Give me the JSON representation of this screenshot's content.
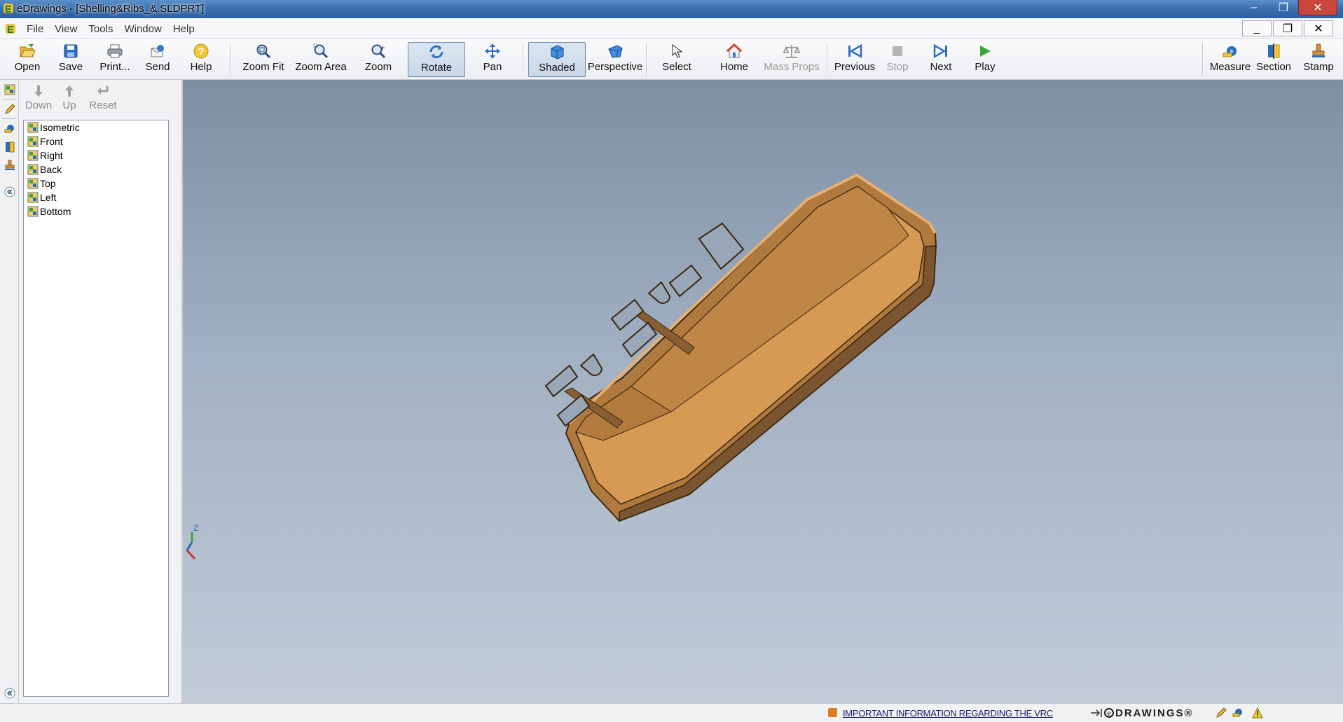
{
  "window": {
    "title": "eDrawings - [Shelling&Ribs_&.SLDPRT]",
    "minimize": "–",
    "restore": "❐",
    "close": "✕"
  },
  "menu": {
    "items": [
      "File",
      "View",
      "Tools",
      "Window",
      "Help"
    ],
    "mdi_minimize": "_",
    "mdi_restore": "❐",
    "mdi_close": "✕"
  },
  "toolbar": {
    "open": "Open",
    "save": "Save",
    "print": "Print...",
    "send": "Send",
    "help": "Help",
    "zoom_fit": "Zoom Fit",
    "zoom_area": "Zoom Area",
    "zoom": "Zoom",
    "rotate": "Rotate",
    "pan": "Pan",
    "shaded": "Shaded",
    "perspective": "Perspective",
    "select": "Select",
    "home": "Home",
    "mass_props": "Mass Props",
    "previous": "Previous",
    "stop": "Stop",
    "next": "Next",
    "play": "Play",
    "measure": "Measure",
    "section": "Section",
    "stamp": "Stamp"
  },
  "panel": {
    "down": "Down",
    "up": "Up",
    "reset": "Reset",
    "views": [
      "Isometric",
      "Front",
      "Right",
      "Back",
      "Top",
      "Left",
      "Bottom"
    ]
  },
  "triad": {
    "z_label": "Z"
  },
  "status": {
    "link": "IMPORTANT INFORMATION REGARDING THE VRC",
    "brand": "DRAWINGS®"
  },
  "colors": {
    "part_face": "#d79a56",
    "part_dark": "#7a5530",
    "part_mid": "#b07a3f",
    "viewport_top": "#7e8fa3",
    "viewport_bottom": "#c2ccd8"
  }
}
